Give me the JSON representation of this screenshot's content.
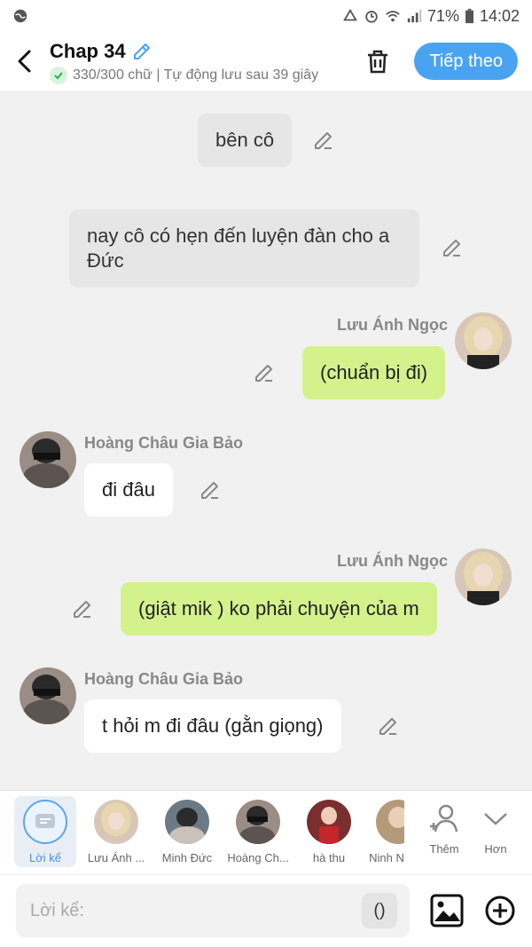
{
  "status": {
    "battery": "71%",
    "time": "14:02"
  },
  "header": {
    "title": "Chap 34",
    "subtitle": "330/300 chữ | Tự động lưu sau 39 giây",
    "next_label": "Tiếp theo"
  },
  "messages": [
    {
      "type": "narration",
      "text": "bên cô"
    },
    {
      "type": "narration",
      "text": "nay cô có hẹn đến luyện đàn cho a Đức"
    },
    {
      "type": "right",
      "name": "Lưu Ánh Ngọc",
      "text": "(chuẩn bị đi)"
    },
    {
      "type": "left",
      "name": "Hoàng Châu Gia Bảo",
      "text": "đi đâu"
    },
    {
      "type": "right",
      "name": "Lưu Ánh Ngọc",
      "text": "(giật mik ) ko phải chuyện của m"
    },
    {
      "type": "left",
      "name": "Hoàng Châu Gia Bảo",
      "text": "t hỏi m đi đâu (gằn giọng)"
    }
  ],
  "characters": [
    {
      "label": "Lời kể",
      "selected": true
    },
    {
      "label": "Lưu Ánh ..."
    },
    {
      "label": "Minh Đức"
    },
    {
      "label": "Hoàng Ch..."
    },
    {
      "label": "hà thu"
    },
    {
      "label": "Ninh N"
    }
  ],
  "actions": {
    "add_label": "Thêm",
    "more_label": "Hơn"
  },
  "input": {
    "placeholder": "Lời kể:",
    "paren_label": "()"
  },
  "colors": {
    "accent": "#4aa3f0",
    "right_bubble": "#d4f28c",
    "narration_bubble": "#e6e6e6"
  }
}
